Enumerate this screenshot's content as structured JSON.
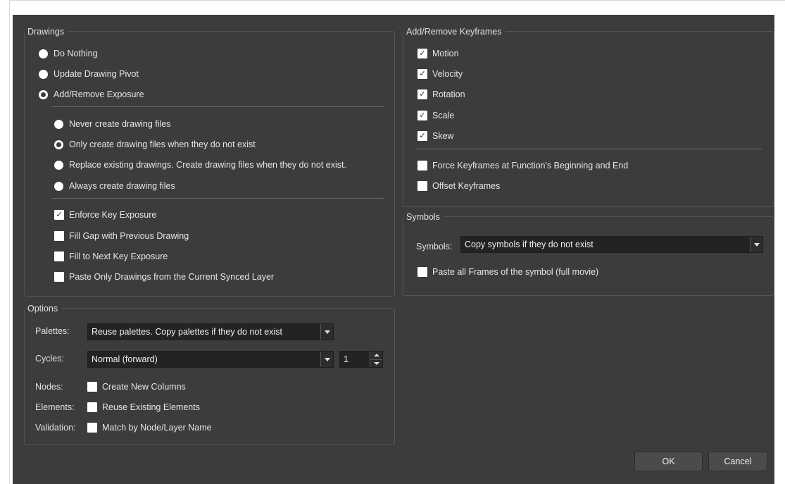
{
  "drawings": {
    "title": "Drawings",
    "options": [
      {
        "label": "Do Nothing",
        "checked": false
      },
      {
        "label": "Update Drawing Pivot",
        "checked": false
      },
      {
        "label": "Add/Remove Exposure",
        "checked": true
      }
    ],
    "sub_options": [
      {
        "label": "Never create drawing files",
        "checked": false
      },
      {
        "label": "Only create drawing files when they do not exist",
        "checked": true
      },
      {
        "label": "Replace existing drawings. Create drawing files when they do not exist.",
        "checked": false
      },
      {
        "label": "Always create drawing files",
        "checked": false
      }
    ],
    "checks": [
      {
        "label": "Enforce Key Exposure",
        "checked": true
      },
      {
        "label": "Fill Gap with Previous Drawing",
        "checked": false
      },
      {
        "label": "Fill to Next Key Exposure",
        "checked": false
      },
      {
        "label": "Paste Only Drawings from the Current Synced Layer",
        "checked": false
      }
    ]
  },
  "keyframes": {
    "title": "Add/Remove Keyframes",
    "checks": [
      {
        "label": "Motion",
        "checked": true
      },
      {
        "label": "Velocity",
        "checked": true
      },
      {
        "label": "Rotation",
        "checked": true
      },
      {
        "label": "Scale",
        "checked": true
      },
      {
        "label": "Skew",
        "checked": true
      }
    ],
    "extra": [
      {
        "label": "Force Keyframes at Function's Beginning and End",
        "checked": false
      },
      {
        "label": "Offset Keyframes",
        "checked": false
      }
    ]
  },
  "symbols": {
    "title": "Symbols",
    "field_label": "Symbols:",
    "value": "Copy symbols if they do not exist",
    "paste_all": {
      "label": "Paste all Frames of the symbol (full movie)",
      "checked": false
    }
  },
  "options": {
    "title": "Options",
    "palettes_label": "Palettes:",
    "palettes_value": "Reuse palettes. Copy palettes if they do not exist",
    "cycles_label": "Cycles:",
    "cycles_value": "Normal (forward)",
    "cycles_count": "1",
    "nodes_label": "Nodes:",
    "nodes_check": {
      "label": "Create New Columns",
      "checked": false
    },
    "elements_label": "Elements:",
    "elements_check": {
      "label": "Reuse Existing Elements",
      "checked": false
    },
    "validation_label": "Validation:",
    "validation_check": {
      "label": "Match by Node/Layer Name",
      "checked": false
    }
  },
  "buttons": {
    "ok": "OK",
    "cancel": "Cancel"
  },
  "icons": {
    "check_mark": "✓"
  }
}
